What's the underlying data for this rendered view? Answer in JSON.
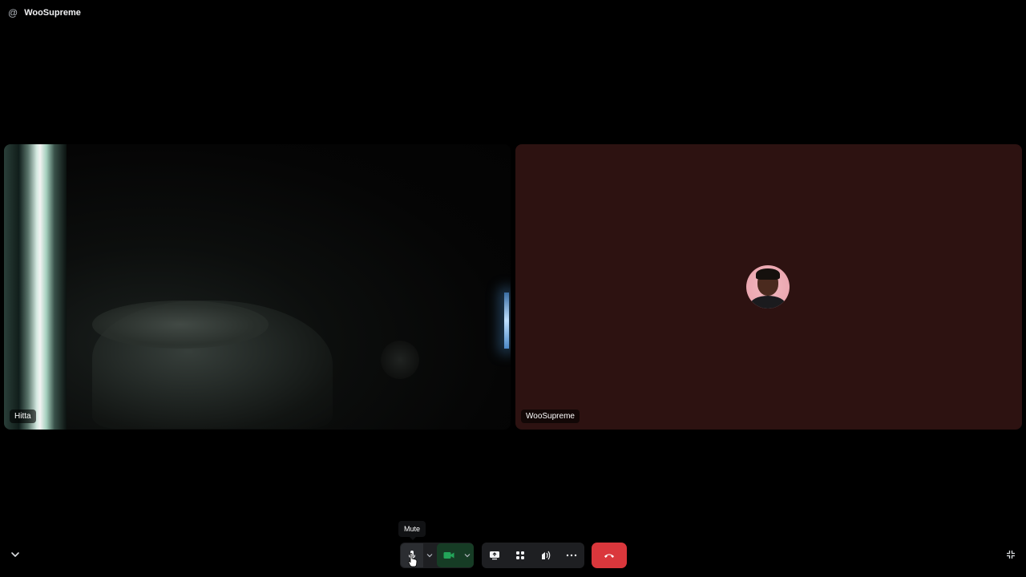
{
  "header": {
    "icon": "at-icon",
    "channel_name": "WooSupreme"
  },
  "participants": [
    {
      "name": "Hitta",
      "video": "camera-on"
    },
    {
      "name": "WooSupreme",
      "video": "avatar-only"
    }
  ],
  "tooltip": {
    "text": "Mute"
  },
  "controls": {
    "mute_icon": "microphone-icon",
    "camera_icon": "video-camera-icon",
    "screen_share_icon": "screen-share-icon",
    "activities_icon": "activities-icon",
    "soundboard_icon": "soundboard-icon",
    "more_icon": "more-icon",
    "disconnect_icon": "hang-up-icon",
    "disconnect_color": "#da373c",
    "camera_on_color": "#23a559"
  }
}
